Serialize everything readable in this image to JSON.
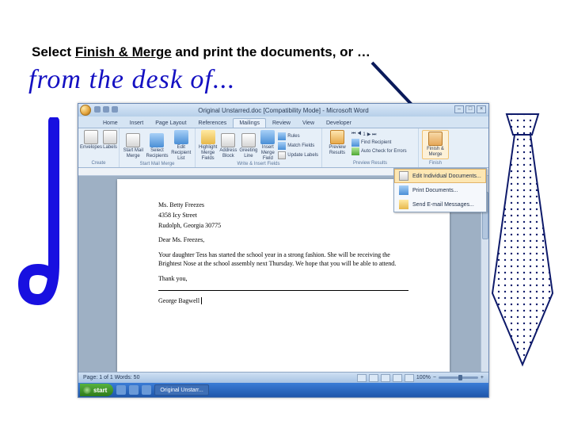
{
  "caption": {
    "pre": "Select ",
    "underlined": "Finish & Merge",
    "post": " and print the documents, or …"
  },
  "desk_of": "from the desk of...",
  "word": {
    "title": "Original Unstarred.doc [Compatibility Mode] - Microsoft Word",
    "tabs": [
      "Home",
      "Insert",
      "Page Layout",
      "References",
      "Mailings",
      "Review",
      "View",
      "Developer"
    ],
    "active_tab": 4,
    "ribbon": {
      "group_create": {
        "label": "Create",
        "envelopes": "Envelopes",
        "labels": "Labels"
      },
      "group_start": {
        "label": "Start Mail Merge",
        "start": "Start Mail Merge",
        "select": "Select Recipients",
        "edit": "Edit Recipient List"
      },
      "group_write": {
        "label": "Write & Insert Fields",
        "highlight": "Highlight Merge Fields",
        "address": "Address Block",
        "greeting": "Greeting Line",
        "insert": "Insert Merge Field",
        "rules": "Rules",
        "match": "Match Fields",
        "update": "Update Labels"
      },
      "group_preview": {
        "label": "Preview Results",
        "preview": "Preview Results",
        "rec": "1",
        "find": "Find Recipient",
        "auto": "Auto Check for Errors"
      },
      "group_finish": {
        "label": "Finish",
        "finish": "Finish & Merge"
      }
    },
    "dropdown": {
      "edit": "Edit Individual Documents...",
      "print": "Print Documents...",
      "email": "Send E-mail Messages..."
    },
    "document": {
      "addr1": "Ms. Betty Freezes",
      "addr2": "4358 Icy Street",
      "addr3": "Rudolph, Georgia 30775",
      "salutation": "Dear Ms. Freezes,",
      "body": "Your daughter Tess has started the school year in a strong fashion. She will be receiving the Brightest Nose at the school assembly next Thursday. We hope that you will be able to attend.",
      "closing": "Thank you,",
      "signature": "George Bagwell"
    },
    "status": {
      "left": "Page: 1 of 1   Words: 50",
      "zoom": "100%"
    },
    "taskbar": {
      "start": "start",
      "doc": "Original Unstarr..."
    }
  }
}
